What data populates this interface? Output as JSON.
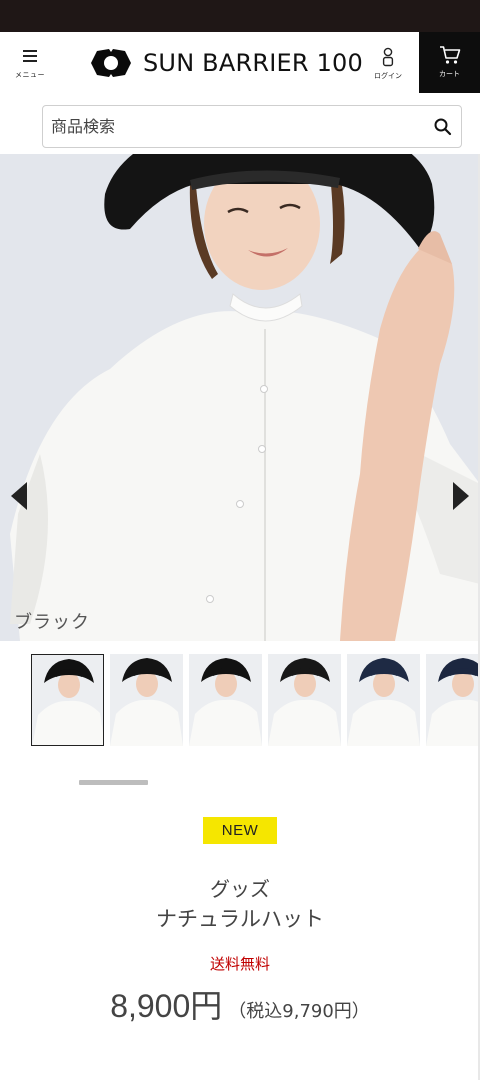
{
  "header": {
    "menu_label": "メニュー",
    "brand": "SUN BARRIER 100",
    "login_label": "ログイン",
    "cart_label": "カート"
  },
  "search": {
    "placeholder": "商品検索"
  },
  "hero": {
    "color_caption": "ブラック"
  },
  "thumbnails": [
    {
      "hat_color": "#111111",
      "selected": true
    },
    {
      "hat_color": "#141414",
      "selected": false
    },
    {
      "hat_color": "#121212",
      "selected": false
    },
    {
      "hat_color": "#181818",
      "selected": false
    },
    {
      "hat_color": "#1e2a44",
      "selected": false
    },
    {
      "hat_color": "#1c2740",
      "selected": false
    }
  ],
  "product": {
    "badge": "NEW",
    "category": "グッズ",
    "name": "ナチュラルハット",
    "shipping": "送料無料",
    "price": "8,900円",
    "price_with_tax": "（税込9,790円）"
  },
  "colors": {
    "badge_bg": "#f5e600",
    "shipping_text": "#c00000",
    "cart_bg": "#0d0d0d",
    "status_bar": "#1f1716"
  }
}
